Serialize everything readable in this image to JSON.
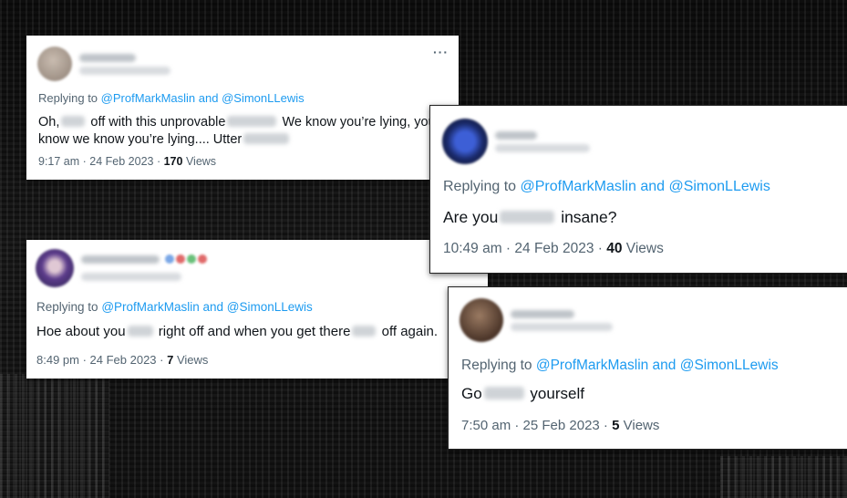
{
  "tweets": [
    {
      "reply_prefix": "Replying to",
      "reply_mentions": "@ProfMarkMaslin and @SimonLLewis",
      "text_1": "Oh,",
      "text_2": "off with this unprovable",
      "text_3": "We know you’re lying, you",
      "text_4": "know we know you’re lying.... Utter",
      "time": "9:17 am · 24 Feb 2023 ·",
      "views_count": "170",
      "views_label": "Views",
      "more_icon": "···"
    },
    {
      "reply_prefix": "Replying to",
      "reply_mentions": "@ProfMarkMaslin and @SimonLLewis",
      "text_1": "Are you",
      "text_2": "insane?",
      "time": "10:49 am · 24 Feb 2023 ·",
      "views_count": "40",
      "views_label": "Views"
    },
    {
      "reply_prefix": "Replying to",
      "reply_mentions": "@ProfMarkMaslin and @SimonLLewis",
      "text_1": "Hoe about you",
      "text_2": "right off and when you get there",
      "text_3": "off again.",
      "time": "8:49 pm · 24 Feb 2023 ·",
      "views_count": "7",
      "views_label": "Views"
    },
    {
      "reply_prefix": "Replying to",
      "reply_mentions": "@ProfMarkMaslin and @SimonLLewis",
      "text_1": "Go",
      "text_2": "yourself",
      "time": "7:50 am · 25 Feb 2023 ·",
      "views_count": "5",
      "views_label": "Views"
    }
  ],
  "colors": {
    "link": "#1d9bf0",
    "muted": "#536471",
    "text": "#0f1419",
    "background": "#161616"
  }
}
